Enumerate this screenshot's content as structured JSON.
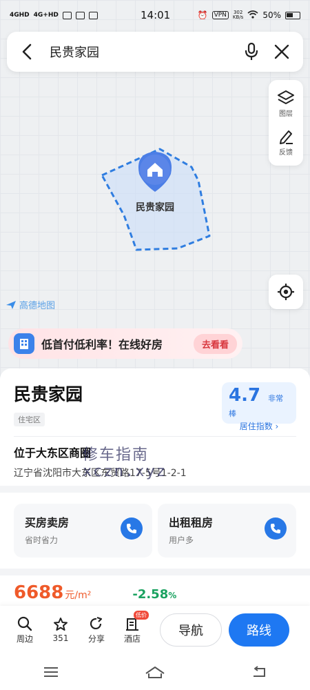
{
  "status": {
    "net1": "4GHD",
    "net2": "4G+HD",
    "time": "14:01",
    "vpn": "VPN",
    "rate_value": "302",
    "rate_unit": "KB/s",
    "battery": "50%"
  },
  "search": {
    "query": "民贵家园"
  },
  "tools": {
    "layers_label": "图层",
    "feedback_label": "反馈"
  },
  "map": {
    "logo_text": "高德地图",
    "pin_label": "民贵家园"
  },
  "promo": {
    "text": "低首付低利率！在线好房",
    "cta": "去看看"
  },
  "place": {
    "name": "民贵家园",
    "type_tag": "住宅区",
    "score": "4.7",
    "score_level": "非常棒",
    "score_index_label": "居住指数 ›",
    "location_title": "位于大东区商圈",
    "address": "辽宁省沈阳市大东区东贸路17-5号1-2-1"
  },
  "services": [
    {
      "title": "买房卖房",
      "subtitle": "省时省力"
    },
    {
      "title": "出租租房",
      "subtitle": "用户多"
    }
  ],
  "price": {
    "value": "6688",
    "unit": "元/m²",
    "change": "-2.58",
    "change_unit": "%"
  },
  "actions": {
    "nearby": "周边",
    "favorites": "351",
    "share": "分享",
    "hotel": "酒店",
    "hotel_badge": "低价",
    "navigate": "导航",
    "route": "路线"
  },
  "watermark": {
    "line1": "修车指南",
    "line2": "xczn.xyz"
  },
  "colors": {
    "accent": "#1e78f2",
    "price": "#ef5a2a",
    "change": "#1aa260",
    "polygon": "#2f7de0"
  }
}
